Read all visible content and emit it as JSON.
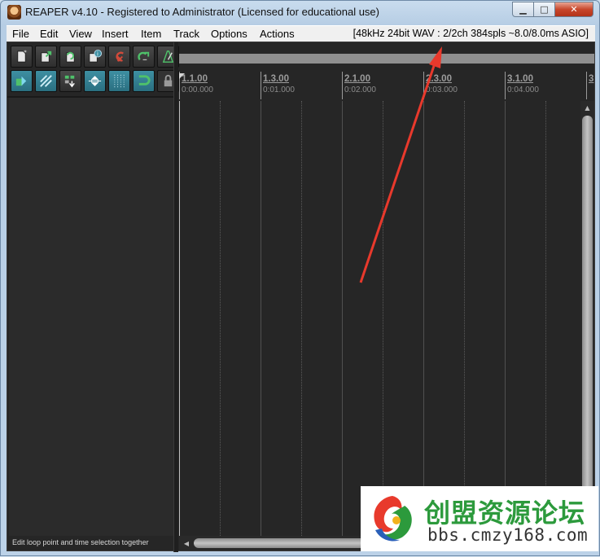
{
  "window": {
    "title": "REAPER v4.10 - Registered to Administrator (Licensed for educational use)",
    "minimize_glyph": "▁",
    "maximize_glyph": "□",
    "close_glyph": "✕"
  },
  "menu": {
    "items": [
      "File",
      "Edit",
      "View",
      "Insert",
      "Item",
      "Track",
      "Options",
      "Actions"
    ],
    "status_info": "[48kHz 24bit WAV : 2/2ch 384spls ~8.0/8.0ms ASIO]"
  },
  "toolbar": {
    "row1": [
      "new-project-icon",
      "open-project-icon",
      "save-project-icon",
      "project-settings-icon",
      "undo-icon",
      "redo-icon",
      "metronome-icon"
    ],
    "row2": [
      "grid-toggle-icon",
      "ripple-edit-icon",
      "item-grouping-icon",
      "snap-toggle-icon",
      "grid-lines-icon",
      "loop-lock-icon",
      "lock-icon"
    ]
  },
  "ruler": {
    "marks": [
      {
        "bar": "1.1.00",
        "time": "0:00.000"
      },
      {
        "bar": "1.3.00",
        "time": "0:01.000"
      },
      {
        "bar": "2.1.00",
        "time": "0:02.000"
      },
      {
        "bar": "2.3.00",
        "time": "0:03.000"
      },
      {
        "bar": "3.1.00",
        "time": "0:04.000"
      },
      {
        "bar": "3",
        "time": ""
      }
    ]
  },
  "help_text": "Edit loop point and time selection together",
  "watermark": {
    "title": "创盟资源论坛",
    "url": "bbs.cmzy168.com"
  },
  "colors": {
    "background": "#262626",
    "tcp": "#2b2b2b",
    "accent_teal": "#3e8fa2",
    "annotation_arrow": "#e8392c",
    "watermark_green": "#2c9a3c"
  }
}
